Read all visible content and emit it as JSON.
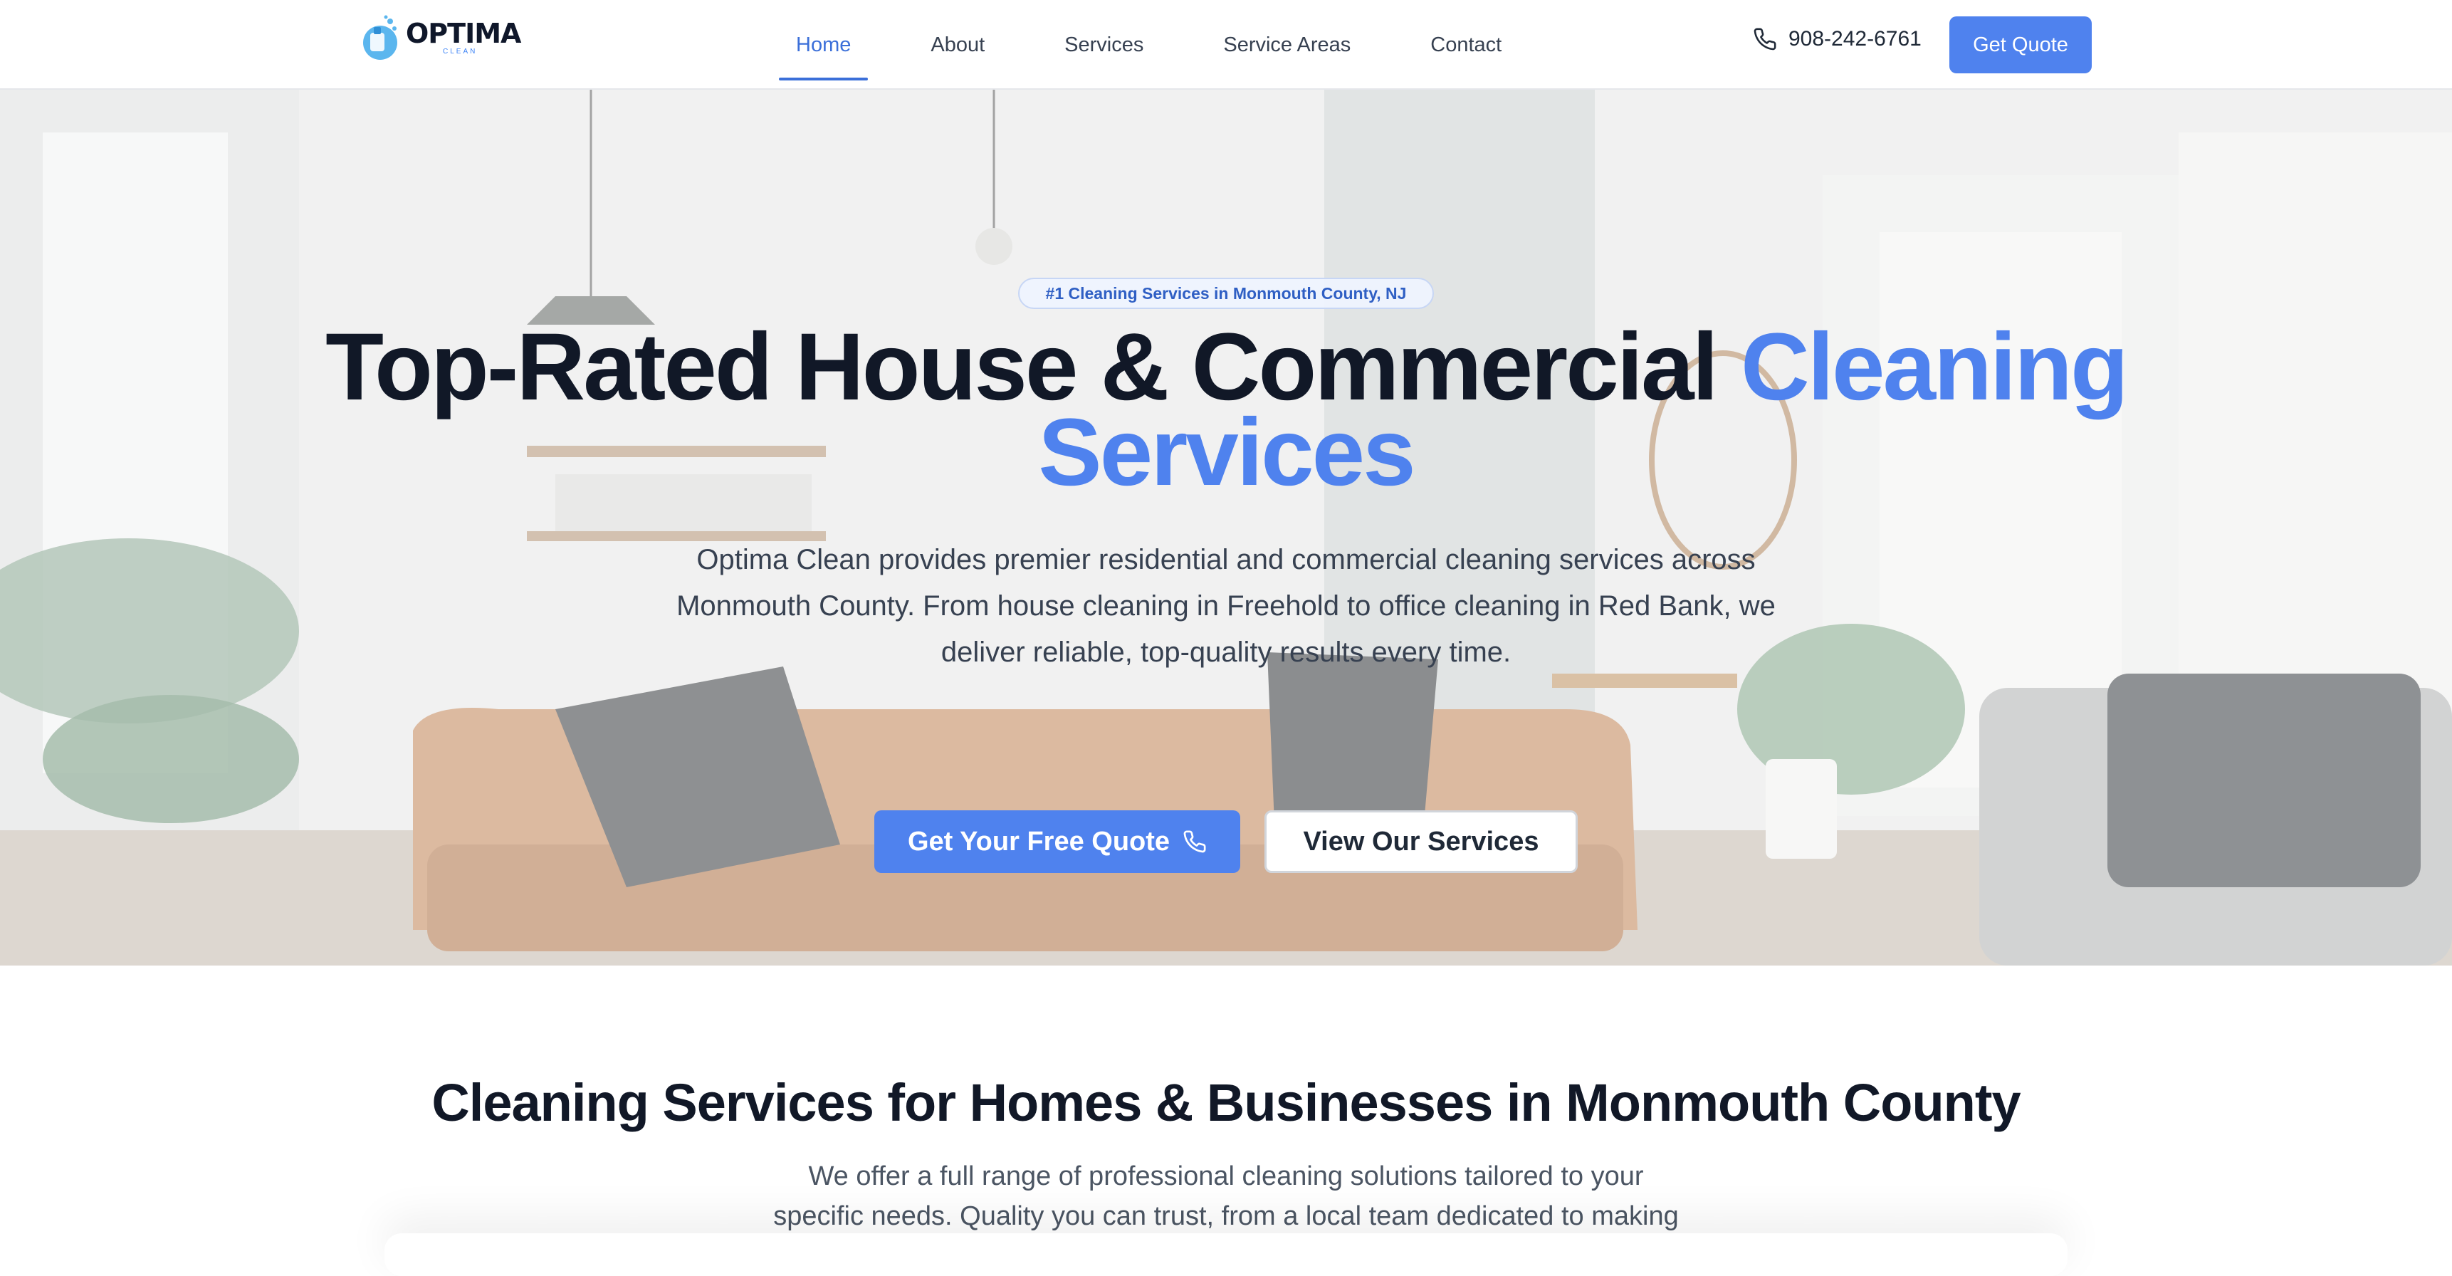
{
  "brand": {
    "name": "OPTIMA",
    "sub": "CLEAN"
  },
  "nav": {
    "items": [
      {
        "label": "Home",
        "active": true
      },
      {
        "label": "About",
        "active": false
      },
      {
        "label": "Services",
        "active": false
      },
      {
        "label": "Service Areas",
        "active": false
      },
      {
        "label": "Contact",
        "active": false
      }
    ],
    "phone": "908-242-6761",
    "phone_icon": "phone-icon",
    "cta": "Get Quote"
  },
  "hero": {
    "badge": "#1 Cleaning Services in Monmouth County, NJ",
    "title_main": "Top-Rated House & Commercial ",
    "title_accent": "Cleaning Services",
    "lead": "Optima Clean provides premier residential and commercial cleaning services across Monmouth County. From house cleaning in Freehold to office cleaning in Red Bank, we deliver reliable, top-quality results every time.",
    "primary_cta": "Get Your Free Quote",
    "secondary_cta": "View Our Services"
  },
  "services_intro": {
    "heading": "Cleaning Services for Homes & Businesses in Monmouth County",
    "text": "We offer a full range of professional cleaning solutions tailored to your specific needs. Quality you can trust, from a local team dedicated to making your space"
  },
  "colors": {
    "accent": "#4f82ee",
    "active_nav": "#3b6fd9",
    "heading": "#111827",
    "body_text": "#374151"
  }
}
